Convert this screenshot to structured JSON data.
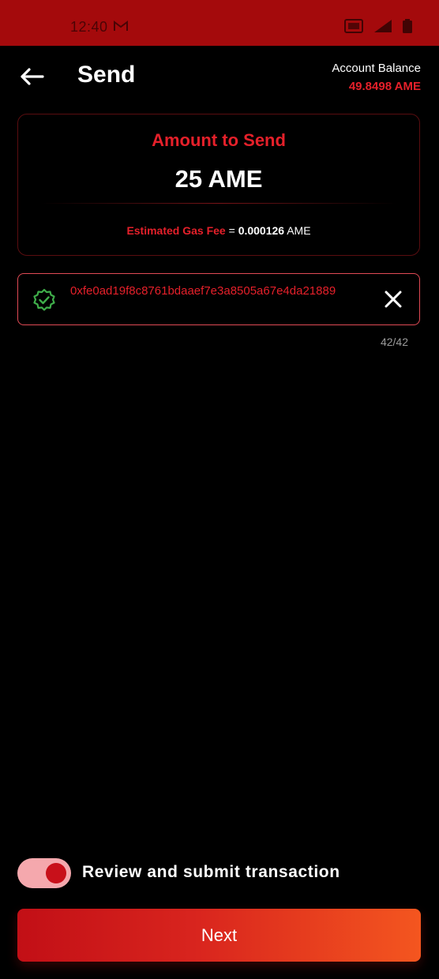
{
  "status_bar": {
    "time": "12:40",
    "icons": [
      "gmail-icon",
      "volte-icon",
      "signal-icon",
      "battery-icon"
    ],
    "background": "#a40a0c"
  },
  "header": {
    "title": "Send",
    "back_icon": "arrow-left-icon",
    "balance_label": "Account Balance",
    "balance_value": "49.8498 AME"
  },
  "amount_card": {
    "label": "Amount to Send",
    "value": "25 AME",
    "gas_label": "Estimated Gas Fee",
    "gas_equals": " = ",
    "gas_value": "0.000126",
    "gas_unit": " AME"
  },
  "address_field": {
    "value": "0xfe0ad19f8c8761bdaaef7e3a8505a67e4da21889",
    "status_icon": "verified-badge-icon",
    "clear_icon": "close-icon",
    "counter": "42/42"
  },
  "review_toggle": {
    "label": "Review and submit transaction",
    "on": true
  },
  "next_button": {
    "label": "Next"
  },
  "colors": {
    "accent_red": "#e5202a",
    "verified_green": "#3fae4a",
    "button_gradient_start": "#c20f16",
    "button_gradient_end": "#f4561f"
  }
}
